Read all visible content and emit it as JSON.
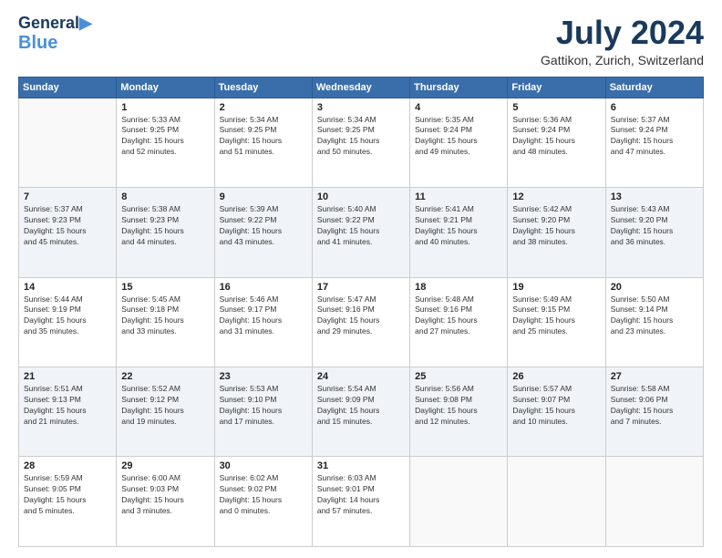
{
  "header": {
    "logo_line1": "General",
    "logo_line2": "Blue",
    "month_year": "July 2024",
    "location": "Gattikon, Zurich, Switzerland"
  },
  "weekdays": [
    "Sunday",
    "Monday",
    "Tuesday",
    "Wednesday",
    "Thursday",
    "Friday",
    "Saturday"
  ],
  "weeks": [
    [
      {
        "day": "",
        "info": ""
      },
      {
        "day": "1",
        "info": "Sunrise: 5:33 AM\nSunset: 9:25 PM\nDaylight: 15 hours\nand 52 minutes."
      },
      {
        "day": "2",
        "info": "Sunrise: 5:34 AM\nSunset: 9:25 PM\nDaylight: 15 hours\nand 51 minutes."
      },
      {
        "day": "3",
        "info": "Sunrise: 5:34 AM\nSunset: 9:25 PM\nDaylight: 15 hours\nand 50 minutes."
      },
      {
        "day": "4",
        "info": "Sunrise: 5:35 AM\nSunset: 9:24 PM\nDaylight: 15 hours\nand 49 minutes."
      },
      {
        "day": "5",
        "info": "Sunrise: 5:36 AM\nSunset: 9:24 PM\nDaylight: 15 hours\nand 48 minutes."
      },
      {
        "day": "6",
        "info": "Sunrise: 5:37 AM\nSunset: 9:24 PM\nDaylight: 15 hours\nand 47 minutes."
      }
    ],
    [
      {
        "day": "7",
        "info": "Sunrise: 5:37 AM\nSunset: 9:23 PM\nDaylight: 15 hours\nand 45 minutes."
      },
      {
        "day": "8",
        "info": "Sunrise: 5:38 AM\nSunset: 9:23 PM\nDaylight: 15 hours\nand 44 minutes."
      },
      {
        "day": "9",
        "info": "Sunrise: 5:39 AM\nSunset: 9:22 PM\nDaylight: 15 hours\nand 43 minutes."
      },
      {
        "day": "10",
        "info": "Sunrise: 5:40 AM\nSunset: 9:22 PM\nDaylight: 15 hours\nand 41 minutes."
      },
      {
        "day": "11",
        "info": "Sunrise: 5:41 AM\nSunset: 9:21 PM\nDaylight: 15 hours\nand 40 minutes."
      },
      {
        "day": "12",
        "info": "Sunrise: 5:42 AM\nSunset: 9:20 PM\nDaylight: 15 hours\nand 38 minutes."
      },
      {
        "day": "13",
        "info": "Sunrise: 5:43 AM\nSunset: 9:20 PM\nDaylight: 15 hours\nand 36 minutes."
      }
    ],
    [
      {
        "day": "14",
        "info": "Sunrise: 5:44 AM\nSunset: 9:19 PM\nDaylight: 15 hours\nand 35 minutes."
      },
      {
        "day": "15",
        "info": "Sunrise: 5:45 AM\nSunset: 9:18 PM\nDaylight: 15 hours\nand 33 minutes."
      },
      {
        "day": "16",
        "info": "Sunrise: 5:46 AM\nSunset: 9:17 PM\nDaylight: 15 hours\nand 31 minutes."
      },
      {
        "day": "17",
        "info": "Sunrise: 5:47 AM\nSunset: 9:16 PM\nDaylight: 15 hours\nand 29 minutes."
      },
      {
        "day": "18",
        "info": "Sunrise: 5:48 AM\nSunset: 9:16 PM\nDaylight: 15 hours\nand 27 minutes."
      },
      {
        "day": "19",
        "info": "Sunrise: 5:49 AM\nSunset: 9:15 PM\nDaylight: 15 hours\nand 25 minutes."
      },
      {
        "day": "20",
        "info": "Sunrise: 5:50 AM\nSunset: 9:14 PM\nDaylight: 15 hours\nand 23 minutes."
      }
    ],
    [
      {
        "day": "21",
        "info": "Sunrise: 5:51 AM\nSunset: 9:13 PM\nDaylight: 15 hours\nand 21 minutes."
      },
      {
        "day": "22",
        "info": "Sunrise: 5:52 AM\nSunset: 9:12 PM\nDaylight: 15 hours\nand 19 minutes."
      },
      {
        "day": "23",
        "info": "Sunrise: 5:53 AM\nSunset: 9:10 PM\nDaylight: 15 hours\nand 17 minutes."
      },
      {
        "day": "24",
        "info": "Sunrise: 5:54 AM\nSunset: 9:09 PM\nDaylight: 15 hours\nand 15 minutes."
      },
      {
        "day": "25",
        "info": "Sunrise: 5:56 AM\nSunset: 9:08 PM\nDaylight: 15 hours\nand 12 minutes."
      },
      {
        "day": "26",
        "info": "Sunrise: 5:57 AM\nSunset: 9:07 PM\nDaylight: 15 hours\nand 10 minutes."
      },
      {
        "day": "27",
        "info": "Sunrise: 5:58 AM\nSunset: 9:06 PM\nDaylight: 15 hours\nand 7 minutes."
      }
    ],
    [
      {
        "day": "28",
        "info": "Sunrise: 5:59 AM\nSunset: 9:05 PM\nDaylight: 15 hours\nand 5 minutes."
      },
      {
        "day": "29",
        "info": "Sunrise: 6:00 AM\nSunset: 9:03 PM\nDaylight: 15 hours\nand 3 minutes."
      },
      {
        "day": "30",
        "info": "Sunrise: 6:02 AM\nSunset: 9:02 PM\nDaylight: 15 hours\nand 0 minutes."
      },
      {
        "day": "31",
        "info": "Sunrise: 6:03 AM\nSunset: 9:01 PM\nDaylight: 14 hours\nand 57 minutes."
      },
      {
        "day": "",
        "info": ""
      },
      {
        "day": "",
        "info": ""
      },
      {
        "day": "",
        "info": ""
      }
    ]
  ]
}
